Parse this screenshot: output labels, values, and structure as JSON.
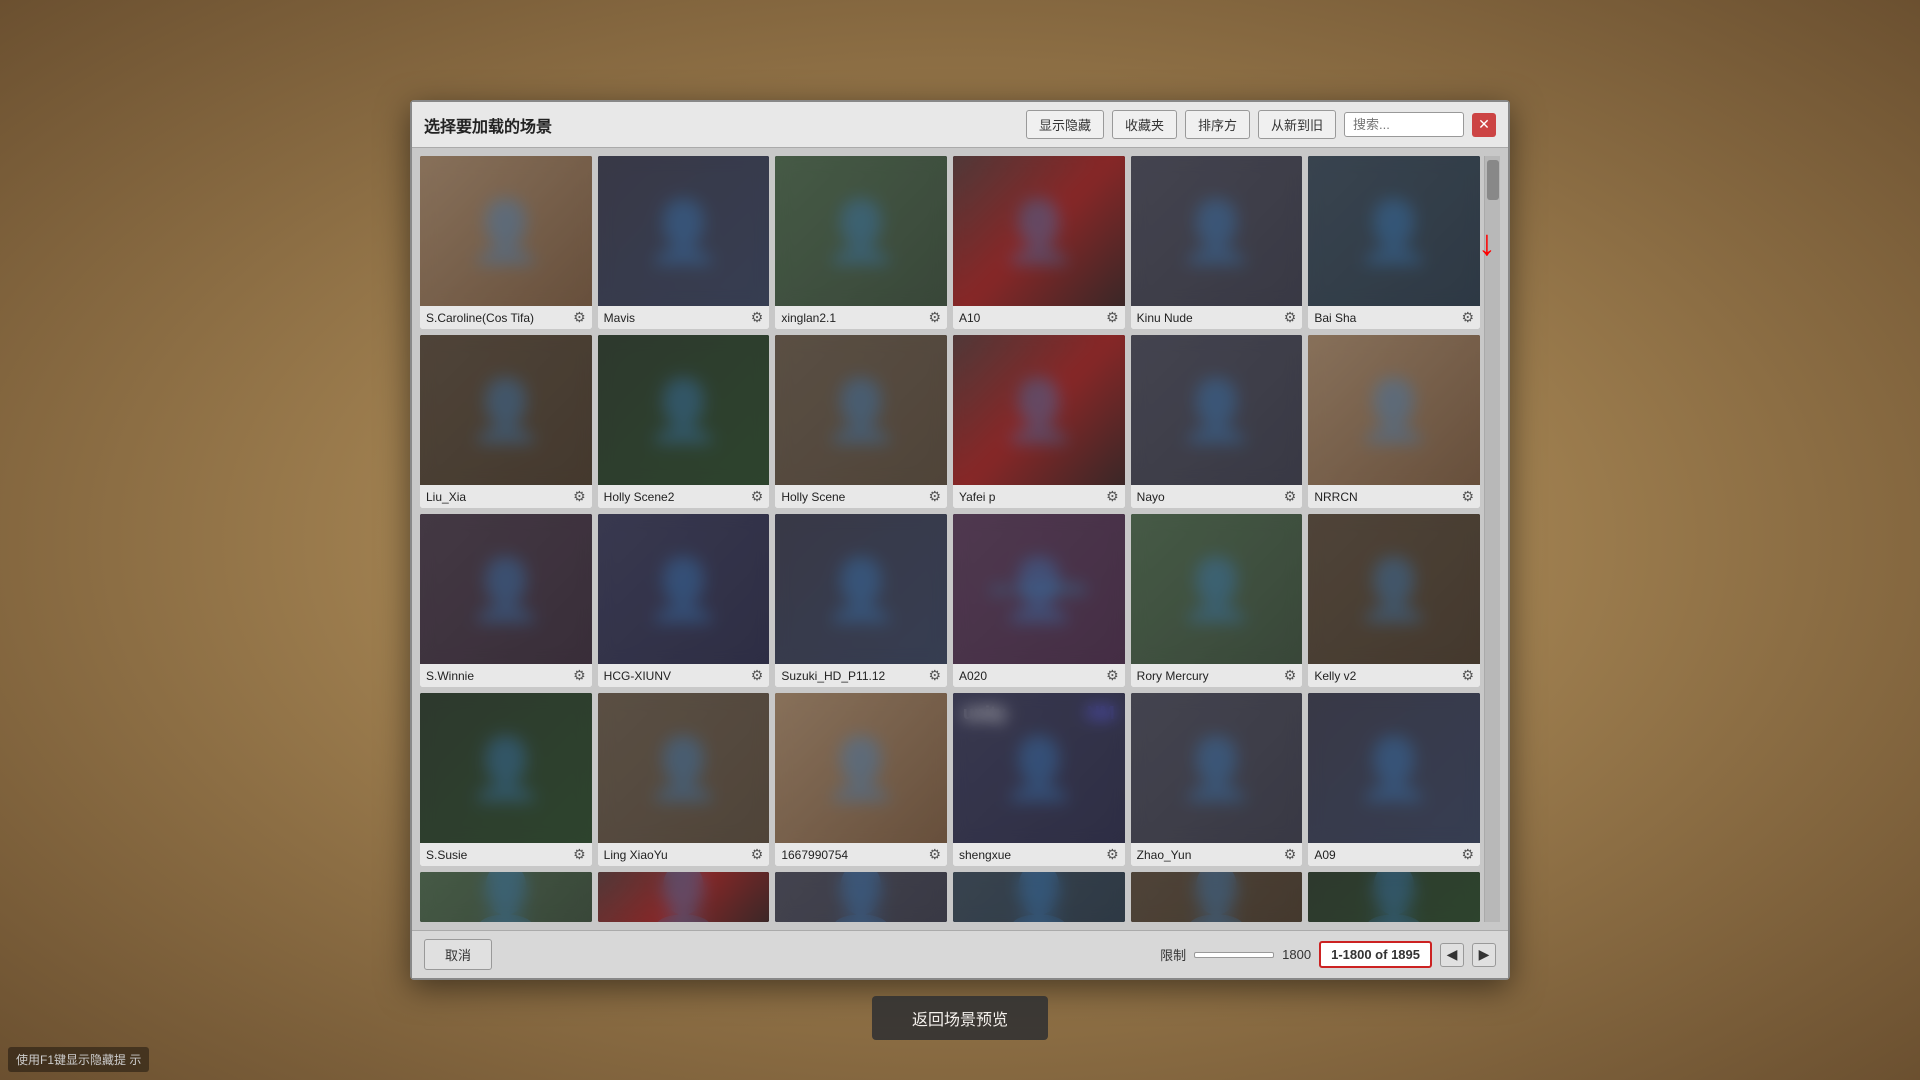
{
  "dialog": {
    "title": "选择要加载的场景",
    "buttons": {
      "show_hidden": "显示隐藏",
      "favorites": "收藏夹",
      "sort": "排序方",
      "newest": "从新到旧",
      "search_placeholder": "搜索...",
      "close": "✕",
      "cancel": "取消",
      "preview": "返回场景预览"
    }
  },
  "pagination": {
    "current": "1-1800 of 1895",
    "limit_label": "限制",
    "limit_value": "1800"
  },
  "hint": {
    "text": "使用F1键显示隐藏提\n示"
  },
  "grid": {
    "rows": [
      [
        {
          "name": "S.Caroline(Cos Tifa)",
          "color": "c1"
        },
        {
          "name": "Mavis",
          "color": "c2"
        },
        {
          "name": "xinglan2.1",
          "color": "c3"
        },
        {
          "name": "A10",
          "color": "c4"
        },
        {
          "name": "Kinu Nude",
          "color": "c5"
        },
        {
          "name": "Bai Sha",
          "color": "c6"
        }
      ],
      [
        {
          "name": "Liu_Xia",
          "color": "c7"
        },
        {
          "name": "Holly Scene2",
          "color": "c8"
        },
        {
          "name": "Holly Scene",
          "color": "c9"
        },
        {
          "name": "Yafei p",
          "color": "c4"
        },
        {
          "name": "Nayo",
          "color": "c5"
        },
        {
          "name": "NRRCN",
          "color": "c1"
        }
      ],
      [
        {
          "name": "S.Winnie",
          "color": "c10"
        },
        {
          "name": "HCG-XIUNV",
          "color": "c11"
        },
        {
          "name": "Suzuki_HD_P11.12",
          "color": "c2"
        },
        {
          "name": "A020",
          "color": "c12",
          "watermark": true
        },
        {
          "name": "Rory Mercury",
          "color": "c3"
        },
        {
          "name": "Kelly v2",
          "color": "c7"
        }
      ],
      [
        {
          "name": "S.Susie",
          "color": "c8"
        },
        {
          "name": "Ling XiaoYu",
          "color": "c9"
        },
        {
          "name": "1667990754",
          "color": "c1"
        },
        {
          "name": "shengxue",
          "color": "c11",
          "unity": true
        },
        {
          "name": "Zhao_Yun",
          "color": "c5"
        },
        {
          "name": "A09",
          "color": "c2"
        }
      ],
      [
        {
          "name": "",
          "color": "c3"
        },
        {
          "name": "",
          "color": "c4"
        },
        {
          "name": "",
          "color": "c5"
        },
        {
          "name": "",
          "color": "c6"
        },
        {
          "name": "",
          "color": "c7"
        },
        {
          "name": "",
          "color": "c8"
        }
      ]
    ]
  }
}
